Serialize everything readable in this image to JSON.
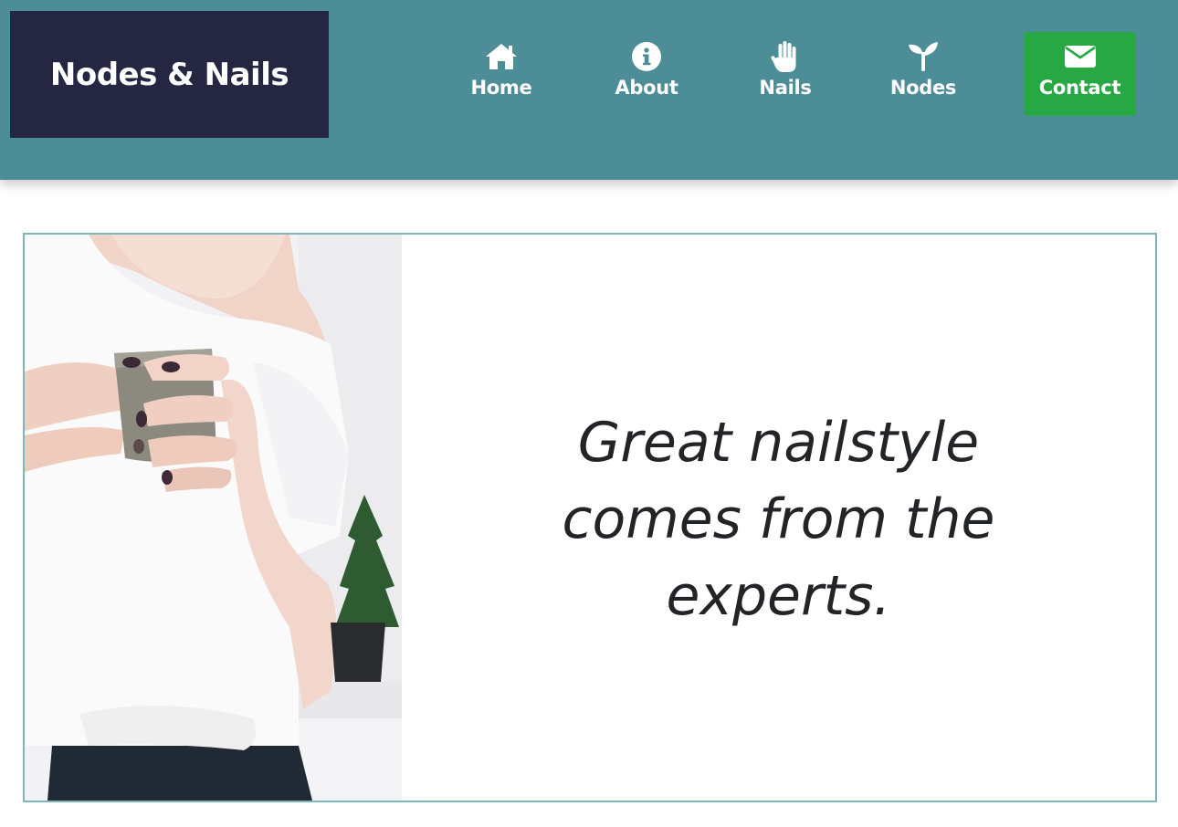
{
  "brand": {
    "name": "Nodes & Nails",
    "colors": {
      "header_bg": "#4d8d97",
      "logo_bg": "#242642",
      "contact_bg": "#28a745",
      "hero_border": "#7fb6bd"
    }
  },
  "nav": {
    "items": [
      {
        "label": "Home",
        "icon": "home-icon"
      },
      {
        "label": "About",
        "icon": "info-circle-icon"
      },
      {
        "label": "Nails",
        "icon": "hand-icon"
      },
      {
        "label": "Nodes",
        "icon": "seedling-icon"
      },
      {
        "label": "Contact",
        "icon": "envelope-icon",
        "highlighted": true
      }
    ]
  },
  "hero": {
    "headline": "Great nailstyle comes from the experts.",
    "image": "photo of a woman in a white t-shirt holding a mug, with a small potted plant"
  }
}
